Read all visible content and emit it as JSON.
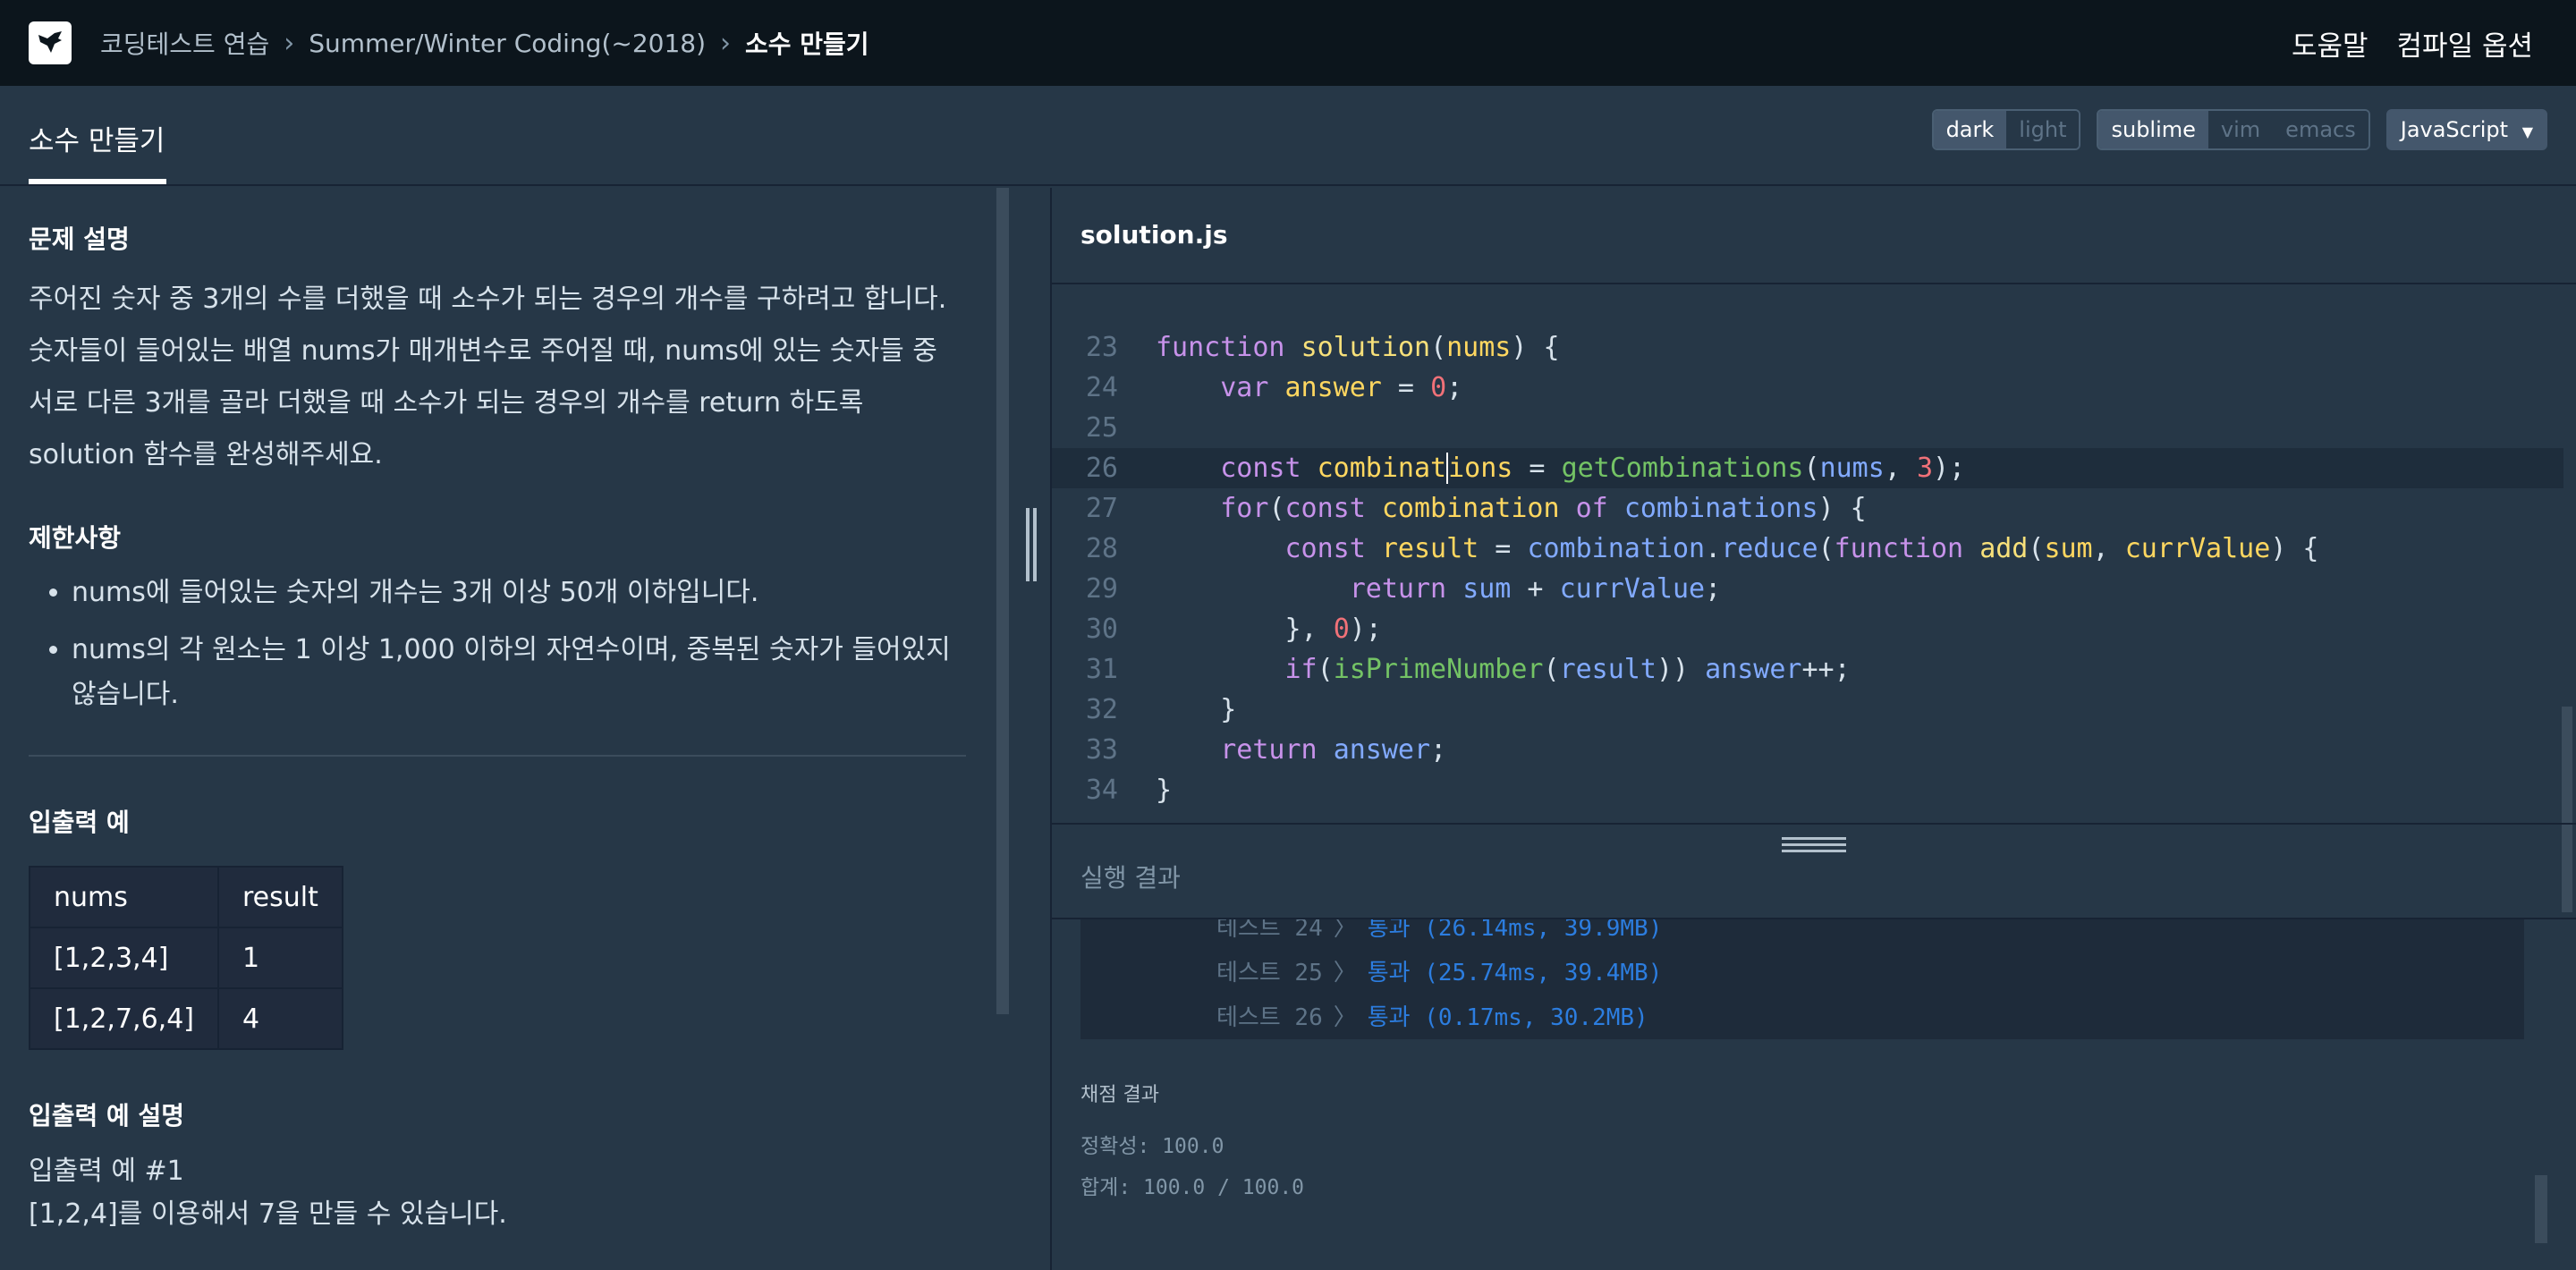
{
  "topnav": {
    "logo_icon": "hummingbird-logo",
    "breadcrumb": [
      "코딩테스트 연습",
      "Summer/Winter Coding(~2018)",
      "소수 만들기"
    ],
    "help_label": "도움말",
    "compile_options_label": "컴파일 옵션"
  },
  "subheader": {
    "lesson_title": "소수 만들기",
    "theme_options": [
      "dark",
      "light"
    ],
    "theme_selected": "dark",
    "keymap_options": [
      "sublime",
      "vim",
      "emacs"
    ],
    "keymap_selected": "sublime",
    "language": "JavaScript"
  },
  "problem": {
    "description_title": "문제 설명",
    "description": "주어진 숫자 중 3개의 수를 더했을 때 소수가 되는 경우의 개수를 구하려고 합니다. 숫자들이 들어있는 배열 nums가 매개변수로 주어질 때, nums에 있는 숫자들 중 서로 다른 3개를 골라 더했을 때 소수가 되는 경우의 개수를 return 하도록 solution 함수를 완성해주세요.",
    "constraints_title": "제한사항",
    "constraints": [
      "nums에 들어있는 숫자의 개수는 3개 이상 50개 이하입니다.",
      "nums의 각 원소는 1 이상 1,000 이하의 자연수이며, 중복된 숫자가 들어있지 않습니다."
    ],
    "io_title": "입출력 예",
    "io_headers": [
      "nums",
      "result"
    ],
    "io_rows": [
      [
        "[1,2,3,4]",
        "1"
      ],
      [
        "[1,2,7,6,4]",
        "4"
      ]
    ],
    "io_explain_title": "입출력 예 설명",
    "io_explain_sub": "입출력 예 #1",
    "io_explain_text": "[1,2,4]를 이용해서 7을 만들 수 있습니다."
  },
  "editor": {
    "file_name": "solution.js",
    "lines": [
      {
        "n": "23",
        "text": "function solution(nums) {"
      },
      {
        "n": "24",
        "text": "    var answer = 0;"
      },
      {
        "n": "25",
        "text": ""
      },
      {
        "n": "26",
        "text": "    const combinations = getCombinations(nums, 3);"
      },
      {
        "n": "27",
        "text": "    for(const combination of combinations) {"
      },
      {
        "n": "28",
        "text": "        const result = combination.reduce(function add(sum, currValue) {"
      },
      {
        "n": "29",
        "text": "            return sum + currValue;"
      },
      {
        "n": "30",
        "text": "        }, 0);"
      },
      {
        "n": "31",
        "text": "        if(isPrimeNumber(result)) answer++;"
      },
      {
        "n": "32",
        "text": "    }"
      },
      {
        "n": "33",
        "text": "    return answer;"
      },
      {
        "n": "34",
        "text": "}"
      }
    ]
  },
  "result": {
    "title": "실행 결과",
    "tests": [
      {
        "label": "테스트 24",
        "result": "통과 (26.14ms, 39.9MB)"
      },
      {
        "label": "테스트 25",
        "result": "통과 (25.74ms, 39.4MB)"
      },
      {
        "label": "테스트 26",
        "result": "통과 (0.17ms, 30.2MB)"
      }
    ],
    "score_title": "채점 결과",
    "accuracy": "정확성: 100.0",
    "total": "합계: 100.0 / 100.0"
  },
  "colors": {
    "nav_bg": "#0c151c",
    "panel_bg": "#263747",
    "pass": "#2c7ddf"
  }
}
